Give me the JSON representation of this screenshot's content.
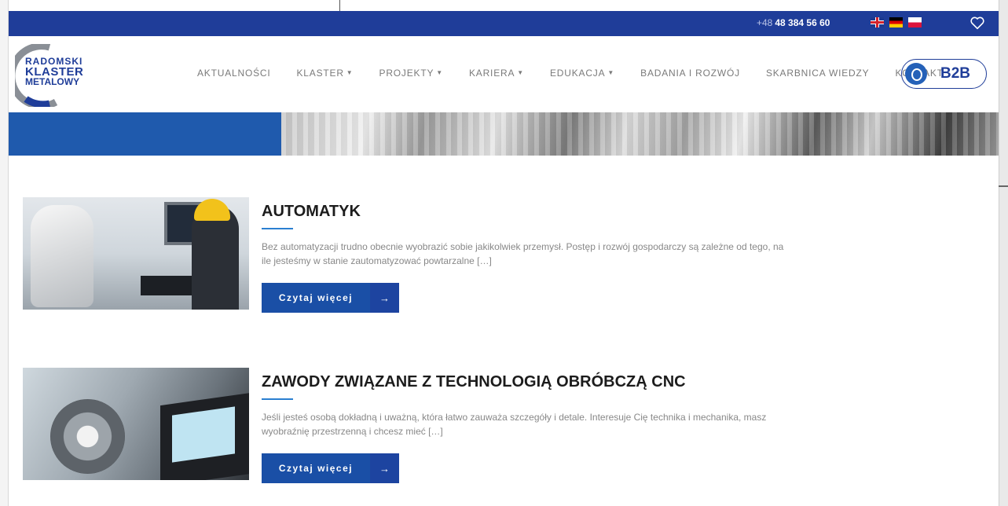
{
  "topbar": {
    "phone_prefix": "+48",
    "phone_number": "48 384 56 60",
    "flags": [
      "flag-uk-icon",
      "flag-de-icon",
      "flag-pl-icon"
    ],
    "wishlist_icon": "heart-icon",
    "color": "#1f3d99"
  },
  "logo": {
    "line1": "RADOMSKI",
    "line2": "KLASTER",
    "line3": "METALOWY"
  },
  "nav": {
    "items": [
      {
        "label": "AKTUALNOŚCI",
        "has_dropdown": false
      },
      {
        "label": "KLASTER",
        "has_dropdown": true
      },
      {
        "label": "PROJEKTY",
        "has_dropdown": true
      },
      {
        "label": "KARIERA",
        "has_dropdown": true
      },
      {
        "label": "EDUKACJA",
        "has_dropdown": true
      },
      {
        "label": "BADANIA I ROZWÓJ",
        "has_dropdown": false
      },
      {
        "label": "SKARBNICA WIEDZY",
        "has_dropdown": false
      },
      {
        "label": "KONTAKT",
        "has_dropdown": false
      }
    ],
    "b2b_label": "B2B",
    "b2b_icon": "handshake-icon"
  },
  "articles": [
    {
      "title": "AUTOMATYK",
      "excerpt_line1": "Bez automatyzacji trudno obecnie wyobrazić sobie jakikolwiek przemysł. Postęp i rozwój gospodarczy są zależne od tego, na",
      "excerpt_line2": "ile jesteśmy w stanie zautomatyzować powtarzalne […]",
      "button_label": "Czytaj więcej",
      "button_arrow": "→"
    },
    {
      "title": "ZAWODY ZWIĄZANE Z TECHNOLOGIĄ OBRÓBCZĄ CNC",
      "excerpt_line1": "Jeśli jesteś osobą dokładną i uważną, która łatwo zauważa szczegóły i detale. Interesuje Cię technika i mechanika, masz",
      "excerpt_line2": "wyobraźnię przestrzenną i chcesz mieć […]",
      "button_label": "Czytaj więcej",
      "button_arrow": "→"
    }
  ],
  "colors": {
    "primary": "#1f3d99",
    "button": "#1a4fa6",
    "accent_underline": "#2a7fd1",
    "banner_blue": "#1f5aad"
  }
}
